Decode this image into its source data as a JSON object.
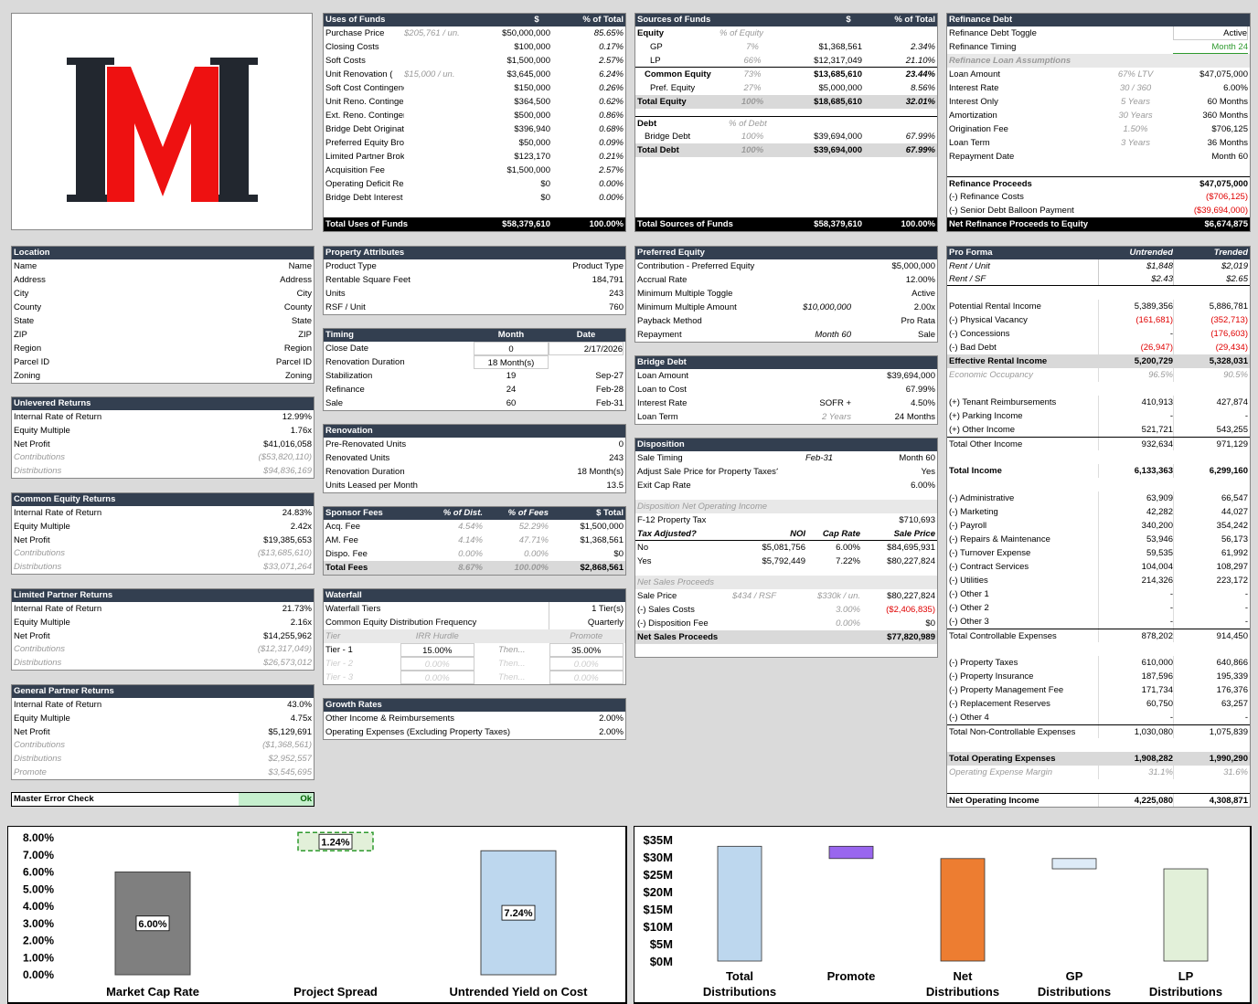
{
  "uses": {
    "title": "Uses of Funds",
    "col_dollar": "$",
    "col_pct": "% of Total",
    "rows": [
      [
        "Purchase Price",
        "$205,761 / un.",
        "$50,000,000",
        "85.65%"
      ],
      [
        "Closing Costs",
        "",
        "$100,000",
        "0.17%"
      ],
      [
        "Soft Costs",
        "",
        "$1,500,000",
        "2.57%"
      ],
      [
        "Unit Renovation (",
        "$15,000 / un.",
        "$3,645,000",
        "6.24%"
      ],
      [
        "Soft Cost Contingency",
        "",
        "$150,000",
        "0.26%"
      ],
      [
        "Unit Reno. Contingency",
        "",
        "$364,500",
        "0.62%"
      ],
      [
        "Ext. Reno. Contingency",
        "",
        "$500,000",
        "0.86%"
      ],
      [
        "Bridge Debt Origination Fee",
        "",
        "$396,940",
        "0.68%"
      ],
      [
        "Preferred Equity Broker Fee",
        "",
        "$50,000",
        "0.09%"
      ],
      [
        "Limited Partner Broker Fee",
        "",
        "$123,170",
        "0.21%"
      ],
      [
        "Acquisition Fee",
        "",
        "$1,500,000",
        "2.57%"
      ],
      [
        "Operating Deficit Reserve",
        "",
        "$0",
        "0.00%"
      ],
      [
        "Bridge Debt Interest Reserve",
        "",
        "$0",
        "0.00%"
      ]
    ],
    "total": [
      "Total Uses of Funds",
      "$58,379,610",
      "100.00%"
    ]
  },
  "sources": {
    "title": "Sources of Funds",
    "col_dollar": "$",
    "col_pct": "% of Total",
    "equity_label": "Equity",
    "equity_pct_label": "% of Equity",
    "equity_rows": [
      [
        "GP",
        "7%",
        "$1,368,561",
        "2.34%"
      ],
      [
        "LP",
        "66%",
        "$12,317,049",
        "21.10%"
      ],
      [
        "Common Equity",
        "73%",
        "$13,685,610",
        "23.44%"
      ],
      [
        "Pref. Equity",
        "27%",
        "$5,000,000",
        "8.56%"
      ]
    ],
    "total_equity": [
      "Total Equity",
      "100%",
      "$18,685,610",
      "32.01%"
    ],
    "debt_label": "Debt",
    "debt_pct_label": "% of Debt",
    "debt_rows": [
      [
        "Bridge Debt",
        "100%",
        "$39,694,000",
        "67.99%"
      ]
    ],
    "total_debt": [
      "Total Debt",
      "100%",
      "$39,694,000",
      "67.99%"
    ],
    "total": [
      "Total Sources of Funds",
      "$58,379,610",
      "100.00%"
    ]
  },
  "refi": {
    "title": "Refinance Debt",
    "toggle": [
      "Refinance Debt Toggle",
      "Active"
    ],
    "timing": [
      "Refinance Timing",
      "Month 24"
    ],
    "assumptions_label": "Refinance Loan Assumptions",
    "rows": [
      [
        "Loan Amount",
        "67% LTV",
        "$47,075,000"
      ],
      [
        "Interest Rate",
        "30 / 360",
        "6.00%"
      ],
      [
        "Interest Only",
        "5 Years",
        "60 Months"
      ],
      [
        "Amortization",
        "30 Years",
        "360 Months"
      ],
      [
        "Origination Fee",
        "1.50%",
        "$706,125"
      ],
      [
        "Loan Term",
        "3 Years",
        "36 Months"
      ],
      [
        "Repayment Date",
        "",
        "Month 60"
      ]
    ],
    "proceeds": [
      "Refinance Proceeds",
      "$47,075,000"
    ],
    "costs": [
      "(-) Refinance Costs",
      "($706,125)"
    ],
    "balloon": [
      "(-) Senior Debt Balloon Payment",
      "($39,694,000)"
    ],
    "net": [
      "Net Refinance Proceeds to Equity",
      "$6,674,875"
    ]
  },
  "location": {
    "title": "Location",
    "rows": [
      [
        "Name",
        "Name"
      ],
      [
        "Address",
        "Address"
      ],
      [
        "City",
        "City"
      ],
      [
        "County",
        "County"
      ],
      [
        "State",
        "State"
      ],
      [
        "ZIP",
        "ZIP"
      ],
      [
        "Region",
        "Region"
      ],
      [
        "Parcel ID",
        "Parcel ID"
      ],
      [
        "Zoning",
        "Zoning"
      ]
    ]
  },
  "unlevered": {
    "title": "Unlevered Returns",
    "rows": [
      [
        "Internal Rate of Return",
        "12.99%"
      ],
      [
        "Equity Multiple",
        "1.76x"
      ],
      [
        "Net Profit",
        "$41,016,058"
      ]
    ],
    "grey": [
      [
        "Contributions",
        "($53,820,110)"
      ],
      [
        "Distributions",
        "$94,836,169"
      ]
    ]
  },
  "common": {
    "title": "Common Equity Returns",
    "rows": [
      [
        "Internal Rate of Return",
        "24.83%"
      ],
      [
        "Equity Multiple",
        "2.42x"
      ],
      [
        "Net Profit",
        "$19,385,653"
      ]
    ],
    "grey": [
      [
        "Contributions",
        "($13,685,610)"
      ],
      [
        "Distributions",
        "$33,071,264"
      ]
    ]
  },
  "lp": {
    "title": "Limited Partner Returns",
    "rows": [
      [
        "Internal Rate of Return",
        "21.73%"
      ],
      [
        "Equity Multiple",
        "2.16x"
      ],
      [
        "Net Profit",
        "$14,255,962"
      ]
    ],
    "grey": [
      [
        "Contributions",
        "($12,317,049)"
      ],
      [
        "Distributions",
        "$26,573,012"
      ]
    ]
  },
  "gp": {
    "title": "General Partner Returns",
    "rows": [
      [
        "Internal Rate of Return",
        "43.0%"
      ],
      [
        "Equity Multiple",
        "4.75x"
      ],
      [
        "Net Profit",
        "$5,129,691"
      ]
    ],
    "grey": [
      [
        "Contributions",
        "($1,368,561)"
      ],
      [
        "Distributions",
        "$2,952,557"
      ],
      [
        "Promote",
        "$3,545,695"
      ]
    ]
  },
  "error": {
    "label": "Master Error Check",
    "value": "Ok"
  },
  "property": {
    "title": "Property Attributes",
    "rows": [
      [
        "Product Type",
        "Product Type"
      ],
      [
        "Rentable Square Feet",
        "184,791"
      ],
      [
        "Units",
        "243"
      ],
      [
        "RSF / Unit",
        "760"
      ]
    ]
  },
  "timing": {
    "title": "Timing",
    "col_month": "Month",
    "col_date": "Date",
    "rows": [
      [
        "Close Date",
        "0",
        "2/17/2026"
      ],
      [
        "Renovation Duration",
        "18 Month(s)",
        ""
      ],
      [
        "Stabilization",
        "19",
        "Sep-27"
      ],
      [
        "Refinance",
        "24",
        "Feb-28"
      ],
      [
        "Sale",
        "60",
        "Feb-31"
      ]
    ]
  },
  "renovation": {
    "title": "Renovation",
    "rows": [
      [
        "Pre-Renovated Units",
        "0"
      ],
      [
        "Renovated Units",
        "243"
      ],
      [
        "Renovation Duration",
        "18 Month(s)"
      ],
      [
        "Units Leased per Month",
        "13.5"
      ]
    ]
  },
  "fees": {
    "title": "Sponsor Fees",
    "cols": [
      "% of Dist.",
      "% of Fees",
      "$ Total"
    ],
    "rows": [
      [
        "Acq. Fee",
        "4.54%",
        "52.29%",
        "$1,500,000"
      ],
      [
        "AM. Fee",
        "4.14%",
        "47.71%",
        "$1,368,561"
      ],
      [
        "Dispo. Fee",
        "0.00%",
        "0.00%",
        "$0"
      ]
    ],
    "total": [
      "Total Fees",
      "8.67%",
      "100.00%",
      "$2,868,561"
    ]
  },
  "waterfall": {
    "title": "Waterfall",
    "tiers": [
      "Waterfall Tiers",
      "1 Tier(s)"
    ],
    "freq": [
      "Common Equity Distribution Frequency",
      "Quarterly"
    ],
    "cols": [
      "Tier",
      "IRR Hurdle",
      "Promote"
    ],
    "rows": [
      [
        "Tier - 1",
        "15.00%",
        "Then...",
        "35.00%"
      ],
      [
        "Tier - 2",
        "0.00%",
        "Then...",
        "0.00%"
      ],
      [
        "Tier - 3",
        "0.00%",
        "Then...",
        "0.00%"
      ]
    ]
  },
  "growth": {
    "title": "Growth Rates",
    "rows": [
      [
        "Other Income & Reimbursements",
        "2.00%"
      ],
      [
        "Operating Expenses (Excluding Property Taxes)",
        "2.00%"
      ]
    ]
  },
  "pref": {
    "title": "Preferred Equity",
    "rows": [
      [
        "Contribution - Preferred Equity",
        "",
        "$5,000,000"
      ],
      [
        "Accrual Rate",
        "",
        "12.00%"
      ],
      [
        "Minimum Multiple Toggle",
        "",
        "Active"
      ],
      [
        "Minimum Multiple Amount",
        "$10,000,000",
        "2.00x"
      ],
      [
        "Payback Method",
        "",
        "Pro Rata"
      ],
      [
        "Repayment",
        "Month 60",
        "Sale"
      ]
    ]
  },
  "bridge": {
    "title": "Bridge Debt",
    "rows": [
      [
        "Loan Amount",
        "",
        "$39,694,000"
      ],
      [
        "Loan to Cost",
        "",
        "67.99%"
      ],
      [
        "Interest Rate",
        "SOFR +",
        "4.50%"
      ],
      [
        "Loan Term",
        "2 Years",
        "24 Months"
      ]
    ]
  },
  "disposition": {
    "title": "Disposition",
    "rows": [
      [
        "Sale Timing",
        "Feb-31",
        "Month 60"
      ],
      [
        "Adjust Sale Price for Property Taxes?",
        "",
        "Yes"
      ],
      [
        "Exit Cap Rate",
        "",
        "6.00%"
      ]
    ],
    "noi_label": "Disposition Net Operating Income",
    "f12": [
      "F-12 Property Tax",
      "$710,693"
    ],
    "cols": [
      "Tax Adjusted?",
      "NOI",
      "Cap Rate",
      "Sale Price"
    ],
    "noi_rows": [
      [
        "No",
        "$5,081,756",
        "6.00%",
        "$84,695,931"
      ],
      [
        "Yes",
        "$5,792,449",
        "7.22%",
        "$80,227,824"
      ]
    ],
    "nsp_label": "Net Sales Proceeds",
    "sale_price": [
      "Sale Price",
      "$434 / RSF",
      "$330k / un.",
      "$80,227,824"
    ],
    "sales_costs": [
      "(-) Sales Costs",
      "",
      "3.00%",
      "($2,406,835)"
    ],
    "dispo_fee": [
      "(-) Disposition Fee",
      "",
      "0.00%",
      "$0"
    ],
    "nsp": [
      "Net Sales Proceeds",
      "$77,820,989"
    ]
  },
  "proforma": {
    "title": "Pro Forma",
    "col1": "Untrended",
    "col2": "Trended",
    "rent_unit": [
      "Rent / Unit",
      "$1,848",
      "$2,019"
    ],
    "rent_sf": [
      "Rent / SF",
      "$2.43",
      "$2.65"
    ],
    "rows": [
      {
        "l": "Potential Rental Income",
        "a": "5,389,356",
        "b": "5,886,781",
        "gap": true
      },
      {
        "l": "(-) Physical Vacancy",
        "a": "(161,681)",
        "b": "(352,713)",
        "red": true
      },
      {
        "l": "(-) Concessions",
        "a": "-",
        "b": "(176,603)",
        "redb": true
      },
      {
        "l": "(-) Bad Debt",
        "a": "(26,947)",
        "b": "(29,434)",
        "red": true
      },
      {
        "l": "Effective Rental Income",
        "a": "5,200,729",
        "b": "5,328,031",
        "totg": true
      },
      {
        "l": "Economic Occupancy",
        "a": "96.5%",
        "b": "90.5%",
        "grey": true
      },
      {
        "l": "(+) Tenant Reimbursements",
        "a": "410,913",
        "b": "427,874",
        "gap": true
      },
      {
        "l": "(+) Parking Income",
        "a": "-",
        "b": "-"
      },
      {
        "l": "(+) Other Income",
        "a": "521,721",
        "b": "543,255"
      },
      {
        "l": "Total Other Income",
        "a": "932,634",
        "b": "971,129",
        "sub": true
      },
      {
        "l": "Total Income",
        "a": "6,133,363",
        "b": "6,299,160",
        "bold": true,
        "gap": true
      },
      {
        "l": "(-) Administrative",
        "a": "63,909",
        "b": "66,547",
        "gap": true
      },
      {
        "l": "(-) Marketing",
        "a": "42,282",
        "b": "44,027"
      },
      {
        "l": "(-) Payroll",
        "a": "340,200",
        "b": "354,242"
      },
      {
        "l": "(-) Repairs & Maintenance",
        "a": "53,946",
        "b": "56,173"
      },
      {
        "l": "(-) Turnover Expense",
        "a": "59,535",
        "b": "61,992"
      },
      {
        "l": "(-) Contract Services",
        "a": "104,004",
        "b": "108,297"
      },
      {
        "l": "(-) Utilities",
        "a": "214,326",
        "b": "223,172"
      },
      {
        "l": "(-) Other 1",
        "a": "-",
        "b": "-"
      },
      {
        "l": "(-) Other 2",
        "a": "-",
        "b": "-"
      },
      {
        "l": "(-) Other 3",
        "a": "-",
        "b": "-"
      },
      {
        "l": "Total Controllable Expenses",
        "a": "878,202",
        "b": "914,450",
        "sub": true
      },
      {
        "l": "(-) Property Taxes",
        "a": "610,000",
        "b": "640,866",
        "gap": true
      },
      {
        "l": "(-) Property Insurance",
        "a": "187,596",
        "b": "195,339"
      },
      {
        "l": "(-) Property Management Fee",
        "a": "171,734",
        "b": "176,376"
      },
      {
        "l": "(-) Replacement Reserves",
        "a": "60,750",
        "b": "63,257"
      },
      {
        "l": "(-) Other 4",
        "a": "-",
        "b": "-"
      },
      {
        "l": "Total Non-Controllable Expenses",
        "a": "1,030,080",
        "b": "1,075,839",
        "sub": true
      },
      {
        "l": "Total Operating Expenses",
        "a": "1,908,282",
        "b": "1,990,290",
        "totg": true,
        "gap": true
      },
      {
        "l": "Operating Expense Margin",
        "a": "31.1%",
        "b": "31.6%",
        "grey": true
      },
      {
        "l": "Net Operating Income",
        "a": "4,225,080",
        "b": "4,308,871",
        "bold": true,
        "sub": true,
        "gap": true
      }
    ]
  },
  "chart_data": [
    {
      "type": "bar",
      "categories": [
        "Market Cap Rate",
        "Project Spread",
        "Untrended Yield on Cost"
      ],
      "values": [
        6.0,
        1.24,
        7.24
      ],
      "labels": [
        "6.00%",
        "1.24%",
        "7.24%"
      ],
      "ylim": [
        0,
        8
      ],
      "yticks": [
        "0.00%",
        "1.00%",
        "2.00%",
        "3.00%",
        "4.00%",
        "5.00%",
        "6.00%",
        "7.00%",
        "8.00%"
      ],
      "colors": [
        "#7f7f7f",
        "#e2f0d9",
        "#bdd7ee"
      ],
      "style": "waterfall"
    },
    {
      "type": "bar",
      "categories": [
        "Total Distributions",
        "Promote",
        "Net Distributions",
        "GP Distributions",
        "LP Distributions"
      ],
      "ranges": [
        [
          0,
          33.07
        ],
        [
          29.53,
          33.07
        ],
        [
          0,
          29.53
        ],
        [
          26.57,
          29.53
        ],
        [
          0,
          26.57
        ]
      ],
      "ylim": [
        0,
        35
      ],
      "yticks": [
        "$0M",
        "$5M",
        "$10M",
        "$15M",
        "$20M",
        "$25M",
        "$30M",
        "$35M"
      ],
      "colors": [
        "#bdd7ee",
        "#9966ee",
        "#ed7d31",
        "#deebf7",
        "#e2f0d9"
      ],
      "style": "waterfall"
    }
  ]
}
